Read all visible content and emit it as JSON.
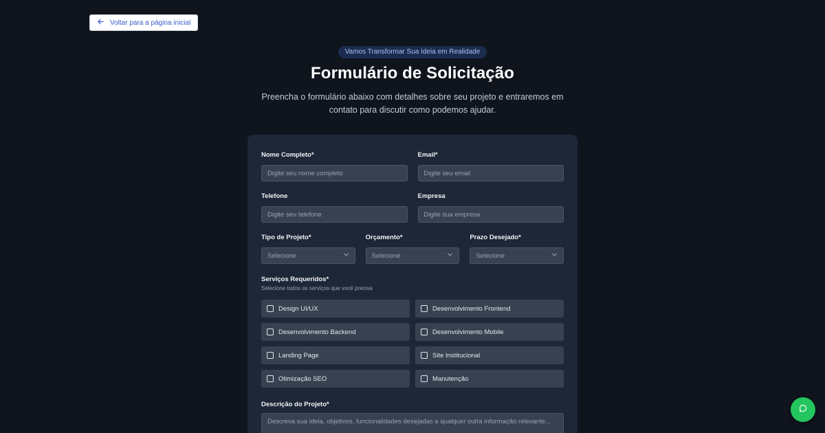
{
  "back_link": {
    "label": "Voltar para a página inicial"
  },
  "hero": {
    "badge": "Vamos Transformar Sua Ideia em Realidade",
    "title": "Formulário de Solicitação",
    "subtitle": "Preencha o formulário abaixo com detalhes sobre seu projeto e entraremos em contato para discutir como podemos ajudar."
  },
  "form": {
    "name": {
      "label": "Nome Completo*",
      "placeholder": "Digite seu nome completo"
    },
    "email": {
      "label": "Email*",
      "placeholder": "Digite seu email"
    },
    "phone": {
      "label": "Telefone",
      "placeholder": "Digite seu telefone"
    },
    "company": {
      "label": "Empresa",
      "placeholder": "Digite sua empresa"
    },
    "project_type": {
      "label": "Tipo de Projeto*",
      "value": "Selecione"
    },
    "budget": {
      "label": "Orçamento*",
      "value": "Selecione"
    },
    "deadline": {
      "label": "Prazo Desejado*",
      "value": "Selecione"
    },
    "services": {
      "label": "Serviços Requeridos*",
      "hint": "Selecione todos os serviços que você precisa",
      "options": [
        {
          "label": "Design UI/UX",
          "checked": false
        },
        {
          "label": "Desenvolvimento Frontend",
          "checked": false
        },
        {
          "label": "Desenvolvimento Backend",
          "checked": false
        },
        {
          "label": "Desenvolvimento Mobile",
          "checked": false
        },
        {
          "label": "Landing Page",
          "checked": false
        },
        {
          "label": "Site Institucional",
          "checked": false
        },
        {
          "label": "Otimização SEO",
          "checked": false
        },
        {
          "label": "Manutenção",
          "checked": false
        }
      ]
    },
    "description": {
      "label": "Descrição do Projeto*",
      "placeholder": "Descreva sua ideia, objetivos, funcionalidades desejadas e qualquer outra informação relevante..."
    }
  },
  "icons": {
    "back": "arrow-left-icon",
    "select": "chevron-down-icon",
    "chat": "chat-bubble-icon"
  },
  "colors": {
    "background": "#0f141d",
    "card": "#1e2738",
    "input": "#374151",
    "badge_bg": "#1b2c4f",
    "badge_text": "#a7c1f5",
    "link": "#3b5bcc",
    "chat_button": "#22c55e"
  }
}
